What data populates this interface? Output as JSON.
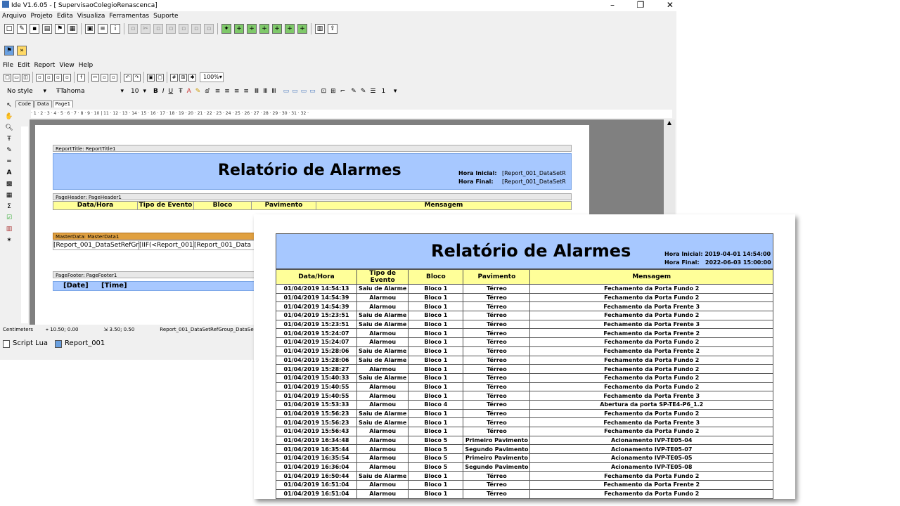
{
  "titlebar": {
    "title": "Ide V1.6.05  - [ SupervisaoColegioRenascenca]",
    "min": "–",
    "restore": "❐",
    "close": "✕"
  },
  "main_menu": [
    "Arquivo",
    "Projeto",
    "Edita",
    "Visualiza",
    "Ferramentas",
    "Suporte"
  ],
  "report_menu": [
    "File",
    "Edit",
    "Report",
    "View",
    "Help"
  ],
  "format_toolbar": {
    "style": "No style",
    "font": "Tahoma",
    "size": "10",
    "zoom": "100%",
    "line_width": "1"
  },
  "designer_tabs": [
    "Code",
    "Data",
    "Page1"
  ],
  "ruler_text": "· 1 · 2 · 3 · 4 · 5 · 6 · 7 · 8 · 9 · 10 | 11 · 12 · 13 · 14 · 15 · 16 · 17 · 18 · 19 · 20 · 21 · 22 · 23 · 24 · 25 · 26 · 27 · 28 · 29 · 30 · 31 · 32 ·",
  "design": {
    "report_title_band": "ReportTitle: ReportTitle1",
    "title": "Relatório de Alarmes",
    "hora_inicial_label": "Hora Inicial:",
    "hora_final_label": "Hora Final:",
    "hora_inicial_value": "[Report_001_DataSetR",
    "hora_final_value": "[Report_001_DataSetR",
    "page_header_band": "PageHeader: PageHeader1",
    "headers": [
      "Data/Hora",
      "Tipo de Evento",
      "Bloco",
      "Pavimento",
      "Mensagem"
    ],
    "master_band": "MasterData: MasterData1",
    "master_fields": [
      "[Report_001_DataSetRefGro",
      "[IIF(<Report_001",
      "[Report_001_Data"
    ],
    "page_footer_band": "PageFooter: PageFooter1",
    "footer_fields": [
      "[Date]",
      "[Time]"
    ]
  },
  "status": {
    "units": "Centimeters",
    "pos": "10.50; 0.00",
    "size": "3.50; 0.50",
    "object": "Report_001_DataSetRefGroup_DataSet"
  },
  "doc_tabs": [
    "Script Lua",
    "Report_001"
  ],
  "preview": {
    "title": "Relatório de Alarmes",
    "hora_inicial": "Hora Inicial: 2019-04-01 14:54:00",
    "hora_final": "Hora Final:   2022-06-03 15:00:00",
    "headers": [
      "Data/Hora",
      "Tipo de Evento",
      "Bloco",
      "Pavimento",
      "Mensagem"
    ],
    "rows": [
      [
        "01/04/2019 14:54:13",
        "Saiu de Alarme",
        "Bloco 1",
        "Térreo",
        "Fechamento da Porta Fundo 2"
      ],
      [
        "01/04/2019 14:54:39",
        "Alarmou",
        "Bloco 1",
        "Térreo",
        "Fechamento da Porta Fundo 2"
      ],
      [
        "01/04/2019 14:54:39",
        "Alarmou",
        "Bloco 1",
        "Térreo",
        "Fechamento da Porta Frente 3"
      ],
      [
        "01/04/2019 15:23:51",
        "Saiu de Alarme",
        "Bloco 1",
        "Térreo",
        "Fechamento da Porta Fundo 2"
      ],
      [
        "01/04/2019 15:23:51",
        "Saiu de Alarme",
        "Bloco 1",
        "Térreo",
        "Fechamento da Porta Frente 3"
      ],
      [
        "01/04/2019 15:24:07",
        "Alarmou",
        "Bloco 1",
        "Térreo",
        "Fechamento da Porta Frente 2"
      ],
      [
        "01/04/2019 15:24:07",
        "Alarmou",
        "Bloco 1",
        "Térreo",
        "Fechamento da Porta Fundo 2"
      ],
      [
        "01/04/2019 15:28:06",
        "Saiu de Alarme",
        "Bloco 1",
        "Térreo",
        "Fechamento da Porta Frente 2"
      ],
      [
        "01/04/2019 15:28:06",
        "Saiu de Alarme",
        "Bloco 1",
        "Térreo",
        "Fechamento da Porta Fundo 2"
      ],
      [
        "01/04/2019 15:28:27",
        "Alarmou",
        "Bloco 1",
        "Térreo",
        "Fechamento da Porta Fundo 2"
      ],
      [
        "01/04/2019 15:40:33",
        "Saiu de Alarme",
        "Bloco 1",
        "Térreo",
        "Fechamento da Porta Fundo 2"
      ],
      [
        "01/04/2019 15:40:55",
        "Alarmou",
        "Bloco 1",
        "Térreo",
        "Fechamento da Porta Fundo 2"
      ],
      [
        "01/04/2019 15:40:55",
        "Alarmou",
        "Bloco 1",
        "Térreo",
        "Fechamento da Porta Frente 3"
      ],
      [
        "01/04/2019 15:53:33",
        "Alarmou",
        "Bloco 4",
        "Térreo",
        "Abertura da porta SP-TE4-P6_1.2"
      ],
      [
        "01/04/2019 15:56:23",
        "Saiu de Alarme",
        "Bloco 1",
        "Térreo",
        "Fechamento da Porta Fundo 2"
      ],
      [
        "01/04/2019 15:56:23",
        "Saiu de Alarme",
        "Bloco 1",
        "Térreo",
        "Fechamento da Porta Frente 3"
      ],
      [
        "01/04/2019 15:56:43",
        "Alarmou",
        "Bloco 1",
        "Térreo",
        "Fechamento da Porta Fundo 2"
      ],
      [
        "01/04/2019 16:34:48",
        "Alarmou",
        "Bloco 5",
        "Primeiro Pavimento",
        "Acionamento IVP-TE05-04"
      ],
      [
        "01/04/2019 16:35:44",
        "Alarmou",
        "Bloco 5",
        "Segundo Pavimento",
        "Acionamento IVP-TE05-07"
      ],
      [
        "01/04/2019 16:35:54",
        "Alarmou",
        "Bloco 5",
        "Primeiro Pavimento",
        "Acionamento IVP-TE05-05"
      ],
      [
        "01/04/2019 16:36:04",
        "Alarmou",
        "Bloco 5",
        "Segundo Pavimento",
        "Acionamento IVP-TE05-08"
      ],
      [
        "01/04/2019 16:50:44",
        "Saiu de Alarme",
        "Bloco 1",
        "Térreo",
        "Fechamento da Porta Fundo 2"
      ],
      [
        "01/04/2019 16:51:04",
        "Alarmou",
        "Bloco 1",
        "Térreo",
        "Fechamento da Porta Frente 2"
      ],
      [
        "01/04/2019 16:51:04",
        "Alarmou",
        "Bloco 1",
        "Térreo",
        "Fechamento da Porta Fundo 2"
      ]
    ]
  }
}
